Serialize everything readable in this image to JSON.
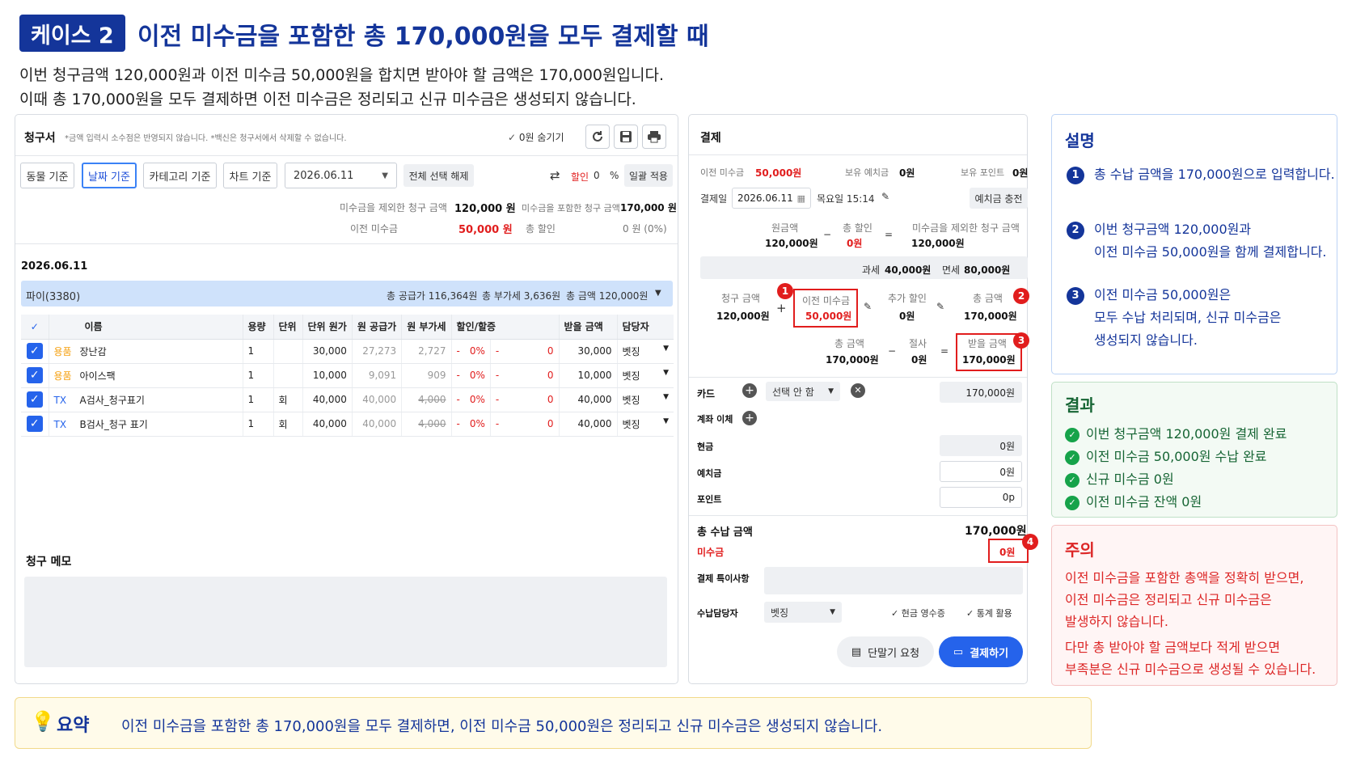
{
  "header": {
    "badge": "케이스 2",
    "title": "이전 미수금을 포함한 총 170,000원을 모두 결제할 때",
    "line1": "이번 청구금액 120,000원과 이전 미수금 50,000원을 합치면 받아야 할 금액은 170,000원입니다.",
    "line2": "이때 총 170,000원을 모두 결제하면 이전 미수금은 정리되고 신규 미수금은 생성되지 않습니다."
  },
  "invoice": {
    "title": "청구서",
    "note": "*금액 입력시 소수점은 반영되지 않습니다. *백신은 청구서에서 삭제할 수 없습니다.",
    "hide_zero": "0원 숨기기",
    "filters": [
      "동물 기준",
      "날짜 기준",
      "카테고리 기준",
      "차트 기준"
    ],
    "date_select": "2026.06.11",
    "deselect_all": "전체 선택 해제",
    "discount_label": "할인",
    "discount_value": "0",
    "percent": "%",
    "bulk_apply": "일괄 적용",
    "excl_label": "미수금을 제외한 청구 금액",
    "excl_value": "120,000 원",
    "incl_label": "미수금을 포함한 청구 금액",
    "incl_value": "170,000 원",
    "prev_label": "이전 미수금",
    "prev_value": "50,000 원",
    "total_disc_label": "총 할인",
    "total_disc_value": "0 원 (0%)",
    "date_heading": "2026.06.11",
    "group_name": "파이(3380)",
    "group_supply": "총 공급가 116,364원",
    "group_vat": "총 부가세 3,636원",
    "group_total": "총 금액 120,000원",
    "columns": [
      "이름",
      "용량",
      "단위",
      "단위 원가",
      "원 공급가",
      "원 부가세",
      "할인/할증",
      "받을 금액",
      "담당자"
    ],
    "rows": [
      {
        "tag": "용품",
        "name": "장난감",
        "qty": "1",
        "unit": "",
        "price": "30,000",
        "supply": "27,273",
        "vat": "2,727",
        "dash1": "-",
        "pct": "0%",
        "dash2": "-",
        "zero": "0",
        "amount": "30,000",
        "staff": "벳징"
      },
      {
        "tag": "용품",
        "name": "아이스팩",
        "qty": "1",
        "unit": "",
        "price": "10,000",
        "supply": "9,091",
        "vat": "909",
        "dash1": "-",
        "pct": "0%",
        "dash2": "-",
        "zero": "0",
        "amount": "10,000",
        "staff": "벳징"
      },
      {
        "tag": "TX",
        "name": "A검사_청구표기",
        "qty": "1",
        "unit": "회",
        "price": "40,000",
        "supply": "40,000",
        "vat": "4,000",
        "dash1": "-",
        "pct": "0%",
        "dash2": "-",
        "zero": "0",
        "amount": "40,000",
        "staff": "벳징"
      },
      {
        "tag": "TX",
        "name": "B검사_청구 표기",
        "qty": "1",
        "unit": "회",
        "price": "40,000",
        "supply": "40,000",
        "vat": "4,000",
        "dash1": "-",
        "pct": "0%",
        "dash2": "-",
        "zero": "0",
        "amount": "40,000",
        "staff": "벳징"
      }
    ],
    "memo_label": "청구 메모"
  },
  "payment": {
    "title": "결제",
    "prev_label": "이전 미수금",
    "prev_value": "50,000원",
    "deposit_label": "보유 예치금",
    "deposit_value": "0원",
    "points_label": "보유 포인트",
    "points_value": "0원",
    "date_label": "결제일",
    "date_value": "2026.06.11",
    "time_value": "목요일 15:14",
    "charge_btn": "예치금 충전",
    "orig_label": "원금액",
    "orig_value": "120,000원",
    "minus": "−",
    "tdisc_label": "총 할인",
    "tdisc_value": "0원",
    "equals": "=",
    "excl_label": "미수금을 제외한 청구 금액",
    "excl_value": "120,000원",
    "tax_label": "과세",
    "tax_value": "40,000원",
    "free_label": "면세",
    "free_value": "80,000원",
    "bill_label": "청구 금액",
    "bill_value": "120,000원",
    "plus": "+",
    "prevbox_label": "이전 미수금",
    "prevbox_value": "50,000원",
    "extra_label": "추가 할인",
    "extra_value": "0원",
    "total_label": "총 금액",
    "total_value": "170,000원",
    "total2_label": "총 금액",
    "total2_value": "170,000원",
    "cut_label": "절사",
    "cut_value": "0원",
    "recv_label": "받을 금액",
    "recv_value": "170,000원",
    "card_label": "카드",
    "card_select": "선택 안 함",
    "card_value": "170,000원",
    "transfer_label": "계좌 이체",
    "cash_label": "현금",
    "cash_value": "0원",
    "dep_label": "예치금",
    "dep_value": "0원",
    "pt_label": "포인트",
    "pt_value": "0p",
    "paid_label": "총 수납 금액",
    "paid_value": "170,000원",
    "unpaid_label": "미수금",
    "unpaid_value": "0원",
    "memo_label": "결제 특이사항",
    "staff_label": "수납담당자",
    "staff_value": "벳징",
    "cash_receipt": "현금 영수증",
    "stats": "통계 활용",
    "terminal_btn": "단말기 요청",
    "pay_btn": "결제하기",
    "markers": [
      "1",
      "2",
      "3",
      "4"
    ]
  },
  "explain": {
    "title": "설명",
    "steps": [
      {
        "n": "1",
        "l1": "총 수납 금액을 170,000원으로 입력합니다.",
        "l2": "",
        "l3": ""
      },
      {
        "n": "2",
        "l1": "이번 청구금액 120,000원과",
        "l2": "이전 미수금 50,000원을 함께 결제합니다.",
        "l3": ""
      },
      {
        "n": "3",
        "l1": "이전 미수금 50,000원은",
        "l2": "모두 수납 처리되며, 신규 미수금은",
        "l3": "생성되지 않습니다."
      }
    ]
  },
  "result": {
    "title": "결과",
    "items": [
      "이번 청구금액 120,000원 결제 완료",
      "이전 미수금 50,000원 수납 완료",
      "신규 미수금 0원",
      "이전 미수금 잔액 0원"
    ]
  },
  "caution": {
    "title": "주의",
    "lines": [
      "이전 미수금을 포함한 총액을 정확히 받으면,",
      "이전 미수금은 정리되고 신규 미수금은",
      "발생하지 않습니다.",
      "다만 총 받아야 할 금액보다 적게 받으면",
      "부족분은 신규 미수금으로 생성될 수 있습니다."
    ]
  },
  "summary": {
    "label": "요약",
    "text": "이전 미수금을 포함한 총 170,000원을 모두 결제하면, 이전 미수금 50,000원은 정리되고 신규 미수금은 생성되지 않습니다."
  },
  "colors": {
    "brand": "#14359a",
    "accent": "#2563eb",
    "danger": "#e11d1d",
    "success": "#16a34a"
  }
}
